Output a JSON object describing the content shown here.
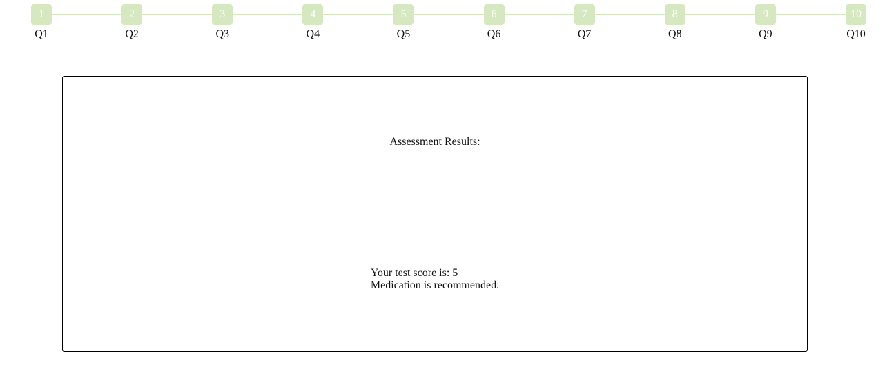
{
  "stepper": {
    "colors": {
      "step_fill": "#d5e8bf",
      "connector": "#d5e8bf",
      "step_text": "#ffffff"
    },
    "steps": [
      {
        "number": "1",
        "label": "Q1"
      },
      {
        "number": "2",
        "label": "Q2"
      },
      {
        "number": "3",
        "label": "Q3"
      },
      {
        "number": "4",
        "label": "Q4"
      },
      {
        "number": "5",
        "label": "Q5"
      },
      {
        "number": "6",
        "label": "Q6"
      },
      {
        "number": "7",
        "label": "Q7"
      },
      {
        "number": "8",
        "label": "Q8"
      },
      {
        "number": "9",
        "label": "Q9"
      },
      {
        "number": "10",
        "label": "Q10"
      }
    ]
  },
  "results": {
    "title": "Assessment Results:",
    "score_line": "Your test score is: 5",
    "recommendation": "Medication is recommended."
  }
}
